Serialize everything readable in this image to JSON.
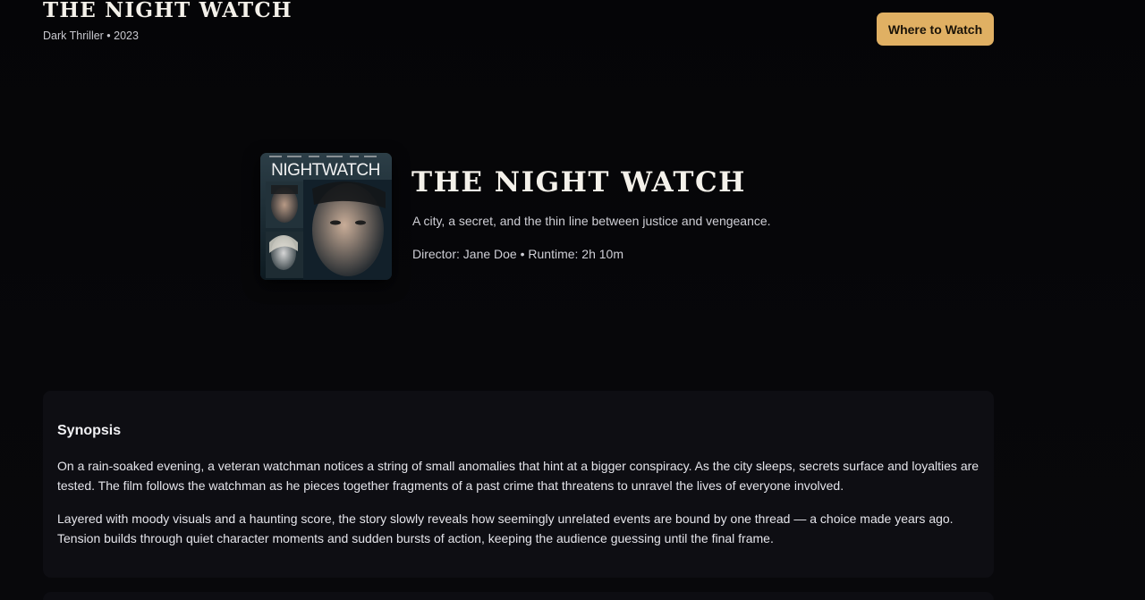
{
  "header": {
    "title": "THE NIGHT WATCH",
    "subtitle": "Dark Thriller • 2023",
    "cta_label": "Where to Watch"
  },
  "hero": {
    "poster_title": "NIGHTWATCH",
    "title": "THE NIGHT WATCH",
    "tagline": "A city, a secret, and the thin line between justice and vengeance.",
    "meta": "Director: Jane Doe • Runtime: 2h 10m"
  },
  "synopsis": {
    "heading": "Synopsis",
    "paragraphs": [
      "On a rain-soaked evening, a veteran watchman notices a string of small anomalies that hint at a bigger conspiracy. As the city sleeps, secrets surface and loyalties are tested. The film follows the watchman as he pieces together fragments of a past crime that threatens to unravel the lives of everyone involved.",
      "Layered with moody visuals and a haunting score, the story slowly reveals how seemingly unrelated events are bound by one thread — a choice made years ago. Tension builds through quiet character moments and sudden bursts of action, keeping the audience guessing until the final frame."
    ]
  },
  "colors": {
    "background": "#050507",
    "accent": "#e0b063",
    "card": "#0e0e13"
  }
}
